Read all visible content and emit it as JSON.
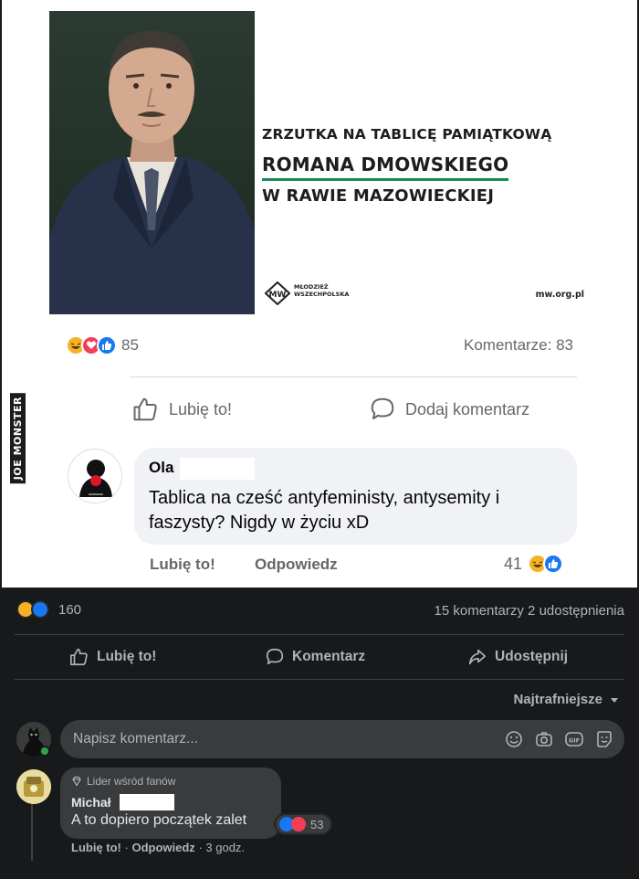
{
  "banner": {
    "line1": "ZRZUTKA NA TABLICĘ PAMIĄTKOWĄ",
    "line2": "ROMANA DMOWSKIEGO",
    "line3": "W RAWIE MAZOWIECKIEJ",
    "org_line1": "MŁODZIEŻ",
    "org_line2": "WSZECHPOLSKA",
    "url": "mw.org.pl"
  },
  "light_post": {
    "reaction_count": "85",
    "comments_label": "Komentarze: 83",
    "like_label": "Lubię to!",
    "comment_label": "Dodaj komentarz",
    "comment": {
      "author": "Ola",
      "text": "Tablica na cześć antyfeministy, antysemity i faszysty? Nigdy w życiu xD",
      "like_label": "Lubię to!",
      "reply_label": "Odpowiedz",
      "reaction_count": "41"
    }
  },
  "watermark": "JOE MONSTER",
  "fb_post": {
    "reaction_count": "160",
    "comments_shares": "15 komentarzy  2 udostępnienia",
    "actions": {
      "like": "Lubię to!",
      "comment": "Komentarz",
      "share": "Udostępnij"
    },
    "sort_label": "Najtrafniejsze",
    "input_placeholder": "Napisz komentarz...",
    "comment": {
      "badge": "Lider wśród fanów",
      "author": "Michał",
      "text": "A to dopiero początek zalet",
      "reaction_count": "53",
      "like": "Lubię to!",
      "reply": "Odpowiedz",
      "time": "3 godz."
    }
  },
  "colors": {
    "dark_bg": "#18191a",
    "bubble_dark": "#3a3b3c",
    "green_underline": "#1e8a55",
    "fb_blue": "#1877f2"
  }
}
